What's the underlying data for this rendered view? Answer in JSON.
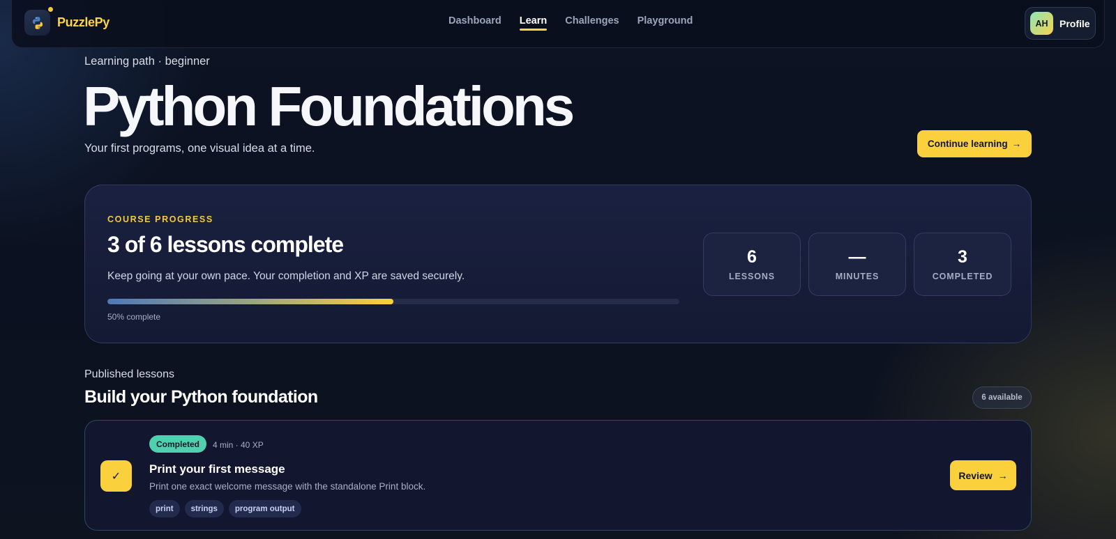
{
  "header": {
    "brand": "PuzzlePy",
    "nav": [
      {
        "label": "Dashboard",
        "active": false
      },
      {
        "label": "Learn",
        "active": true
      },
      {
        "label": "Challenges",
        "active": false
      },
      {
        "label": "Playground",
        "active": false
      }
    ],
    "profile": {
      "initials": "AH",
      "label": "Profile"
    }
  },
  "hero": {
    "eyebrow": "Learning path · beginner",
    "title": "Python Foundations",
    "subtitle": "Your first programs, one visual idea at a time.",
    "cta_label": "Continue learning",
    "cta_arrow": "→"
  },
  "progress": {
    "kicker": "COURSE PROGRESS",
    "title": "3 of 6 lessons complete",
    "description": "Keep going at your own pace. Your completion and XP are saved securely.",
    "percent": 50,
    "percent_label": "50% complete",
    "stats": [
      {
        "value": "6",
        "label": "LESSONS"
      },
      {
        "value": "—",
        "label": "MINUTES"
      },
      {
        "value": "3",
        "label": "COMPLETED"
      }
    ]
  },
  "lessons": {
    "eyebrow": "Published lessons",
    "title": "Build your Python foundation",
    "available_label": "6 available",
    "items": [
      {
        "status": "Completed",
        "meta": "4 min · 40 XP",
        "check": "✓",
        "title": "Print your first message",
        "description": "Print one exact welcome message with the standalone Print block.",
        "tags": [
          "print",
          "strings",
          "program output"
        ],
        "action_label": "Review",
        "action_arrow": "→"
      }
    ]
  },
  "colors": {
    "accent": "#fbd03d",
    "success": "#4fd1b0",
    "background": "#0b1120"
  },
  "icons": {
    "logo": "python-logo-icon",
    "check": "check-icon",
    "arrow": "arrow-right-icon"
  }
}
